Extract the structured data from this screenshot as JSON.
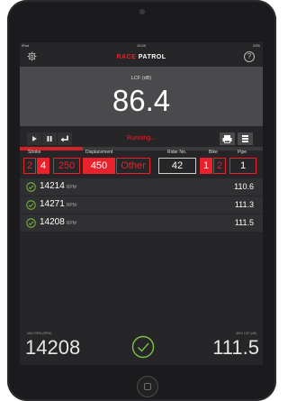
{
  "status_bar": {
    "left": "iPad",
    "time": "10:09",
    "right": "23%"
  },
  "header": {
    "logo_red": "RACE",
    "logo_white": " PATROL",
    "help": "?"
  },
  "meter": {
    "label": "LCF (dB)",
    "value": "86.4",
    "progress": 0.26
  },
  "controls": {
    "status": "Running..."
  },
  "labels": {
    "stroke": "Stroke",
    "displacement": "Displacement",
    "rider_no": "Rider No.",
    "bike": "Bike",
    "pipe": "Pipe"
  },
  "selectors": {
    "stroke": [
      "2",
      "4"
    ],
    "displacement": [
      "250",
      "450",
      "Other"
    ],
    "rider_no": "42",
    "bike": [
      "1",
      "2"
    ],
    "pipe": "1"
  },
  "results": [
    {
      "rpm": "14214",
      "unit": "RPM",
      "db": "110.6"
    },
    {
      "rpm": "14271",
      "unit": "RPM",
      "db": "111.3"
    },
    {
      "rpm": "14208",
      "unit": "RPM",
      "db": "111.5"
    }
  ],
  "bottom": {
    "max_rpm_label": "MAX RPM (RPM)",
    "max_rpm": "14208",
    "max_lcf_label": "MAX LCF (dB)",
    "max_lcf": "111.5"
  },
  "colors": {
    "accent": "#e8212a",
    "ok": "#7cc243"
  }
}
